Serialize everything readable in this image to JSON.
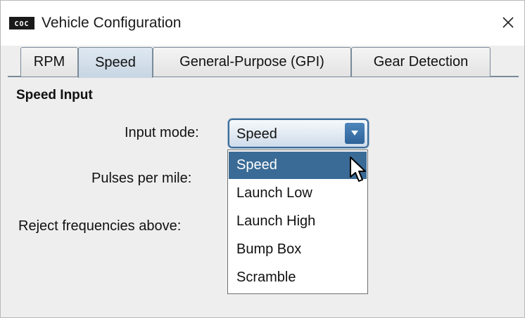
{
  "window": {
    "title": "Vehicle Configuration",
    "app_icon_text": "COC"
  },
  "tabs": [
    {
      "label": "RPM",
      "selected": false
    },
    {
      "label": "Speed",
      "selected": true
    },
    {
      "label": "General-Purpose (GPI)",
      "selected": false
    },
    {
      "label": "Gear Detection",
      "selected": false
    }
  ],
  "section": {
    "title": "Speed Input",
    "fields": {
      "input_mode_label": "Input mode:",
      "pulses_label": "Pulses per mile:",
      "reject_label": "Reject frequencies above:"
    }
  },
  "input_mode": {
    "value": "Speed",
    "options": [
      "Speed",
      "Launch Low",
      "Launch High",
      "Bump Box",
      "Scramble"
    ],
    "highlighted_index": 0
  },
  "colors": {
    "selection": "#3a6b96",
    "tab_border": "#7a8a99",
    "combo_arrow": "#2f6399"
  }
}
